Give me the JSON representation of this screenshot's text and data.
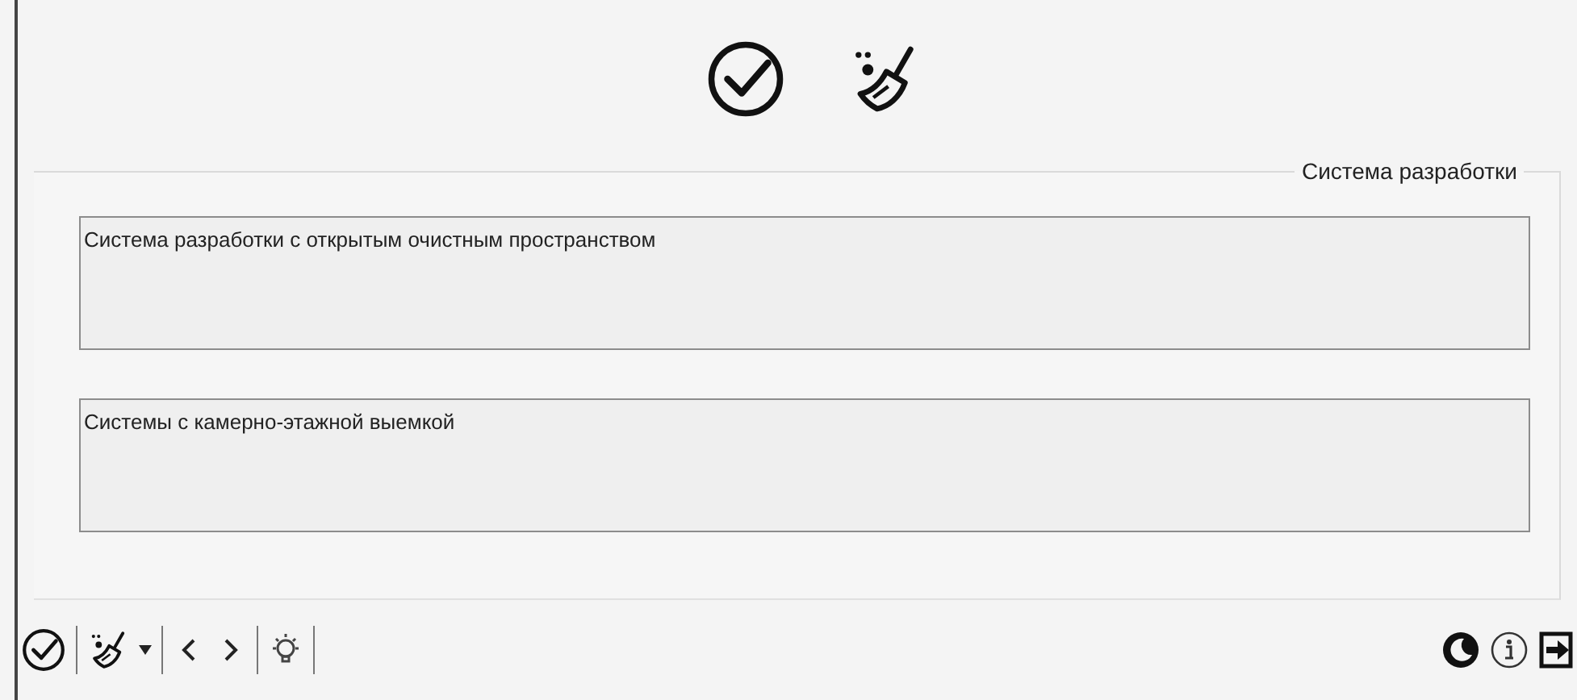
{
  "group": {
    "title": "Система разработки"
  },
  "options": [
    {
      "label": "Система разработки с открытым очистным пространством"
    },
    {
      "label": "Системы с камерно-этажной выемкой"
    }
  ]
}
